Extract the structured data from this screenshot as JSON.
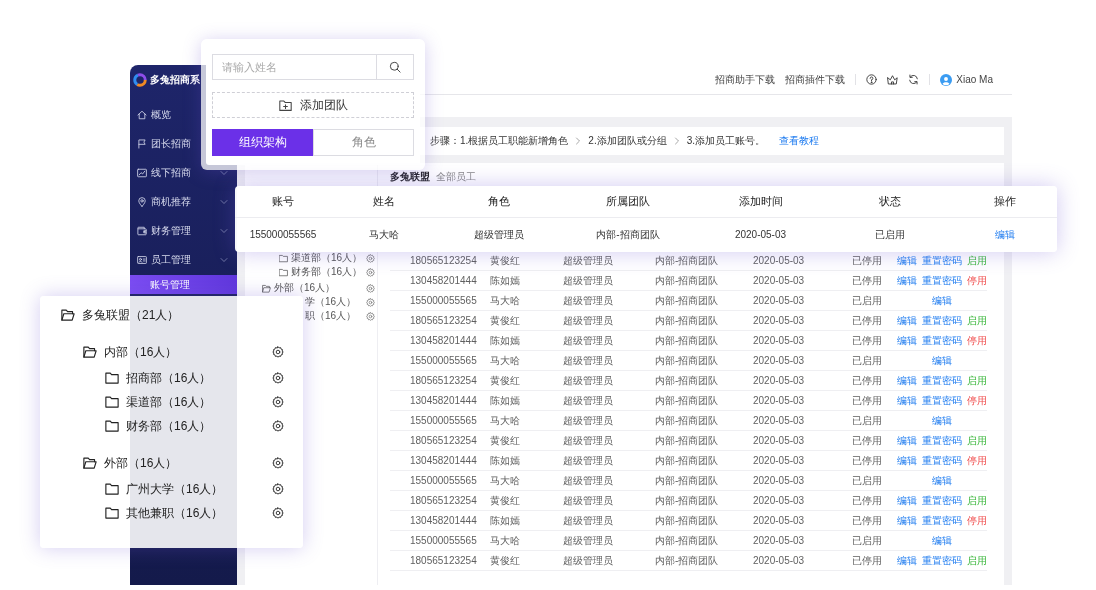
{
  "sidebar": {
    "app_name": "多兔招商系",
    "items": [
      {
        "label": "概览",
        "selected": false
      },
      {
        "label": "团长招商",
        "selected": false
      },
      {
        "label": "线下招商",
        "expandable": true,
        "selected": false
      },
      {
        "label": "商机推荐",
        "expandable": true,
        "selected": false
      },
      {
        "label": "财务管理",
        "expandable": true,
        "selected": false
      },
      {
        "label": "员工管理",
        "expandable": true,
        "selected": false,
        "children": [
          {
            "label": "账号管理",
            "selected": true
          }
        ]
      }
    ]
  },
  "top_bar": {
    "links": [
      "招商助手下载",
      "招商插件下载"
    ],
    "user_name": "Xiao Ma"
  },
  "search_panel": {
    "search": {
      "placeholder": "请输入姓名"
    },
    "add_button": "添加团队",
    "tabs": [
      {
        "label": "组织架构",
        "selected": true
      },
      {
        "label": "角色",
        "selected": false
      }
    ]
  },
  "steps_bar": {
    "steps": [
      "步骤：1.根据员工职能新增角色",
      "2.添加团队或分组",
      "3.添加员工账号。"
    ],
    "link": "查看教程"
  },
  "team_header": {
    "title": "多兔联盟",
    "subtitle": "全部员工"
  },
  "detail_card": {
    "columns": [
      "账号",
      "姓名",
      "角色",
      "所属团队",
      "添加时间",
      "状态",
      "操作"
    ],
    "row": {
      "cells": [
        "155000055565",
        "马大哈",
        "超级管理员",
        "内部-招商团队",
        "2020-05-03",
        "已启用"
      ],
      "actions": [
        {
          "label": "编辑",
          "kind": "edit"
        }
      ]
    }
  },
  "team_tree": [
    {
      "children": [
        {
          "label": "渠道部（16人）",
          "clipped": false
        },
        {
          "label": "财务部（16人）",
          "clipped": false
        }
      ]
    },
    {
      "label": "外部（16人）",
      "clipped": false,
      "children": [
        {
          "label": "学（16人）",
          "clipped": true
        },
        {
          "label": "职（16人）",
          "clipped": true
        }
      ]
    }
  ],
  "employee_table": {
    "rows": [
      {
        "cells": [
          "180565123254",
          "黄俊红",
          "超级管理员",
          "内部-招商团队",
          "2020-05-03",
          "已停用"
        ],
        "actions": [
          {
            "label": "编辑",
            "kind": "edit"
          },
          {
            "label": "重置密码",
            "kind": "reset"
          },
          {
            "label": "启用",
            "kind": "enable"
          }
        ]
      },
      {
        "cells": [
          "130458201444",
          "陈如嫣",
          "超级管理员",
          "内部-招商团队",
          "2020-05-03",
          "已停用"
        ],
        "actions": [
          {
            "label": "编辑",
            "kind": "edit"
          },
          {
            "label": "重置密码",
            "kind": "reset"
          },
          {
            "label": "停用",
            "kind": "disable"
          }
        ]
      },
      {
        "cells": [
          "155000055565",
          "马大哈",
          "超级管理员",
          "内部-招商团队",
          "2020-05-03",
          "已启用"
        ],
        "actions": [
          {
            "label": "编辑",
            "kind": "edit"
          }
        ]
      },
      {
        "cells": [
          "180565123254",
          "黄俊红",
          "超级管理员",
          "内部-招商团队",
          "2020-05-03",
          "已停用"
        ],
        "actions": [
          {
            "label": "编辑",
            "kind": "edit"
          },
          {
            "label": "重置密码",
            "kind": "reset"
          },
          {
            "label": "启用",
            "kind": "enable"
          }
        ]
      },
      {
        "cells": [
          "130458201444",
          "陈如嫣",
          "超级管理员",
          "内部-招商团队",
          "2020-05-03",
          "已停用"
        ],
        "actions": [
          {
            "label": "编辑",
            "kind": "edit"
          },
          {
            "label": "重置密码",
            "kind": "reset"
          },
          {
            "label": "停用",
            "kind": "disable"
          }
        ]
      },
      {
        "cells": [
          "155000055565",
          "马大哈",
          "超级管理员",
          "内部-招商团队",
          "2020-05-03",
          "已启用"
        ],
        "actions": [
          {
            "label": "编辑",
            "kind": "edit"
          }
        ]
      },
      {
        "cells": [
          "180565123254",
          "黄俊红",
          "超级管理员",
          "内部-招商团队",
          "2020-05-03",
          "已停用"
        ],
        "actions": [
          {
            "label": "编辑",
            "kind": "edit"
          },
          {
            "label": "重置密码",
            "kind": "reset"
          },
          {
            "label": "启用",
            "kind": "enable"
          }
        ]
      },
      {
        "cells": [
          "130458201444",
          "陈如嫣",
          "超级管理员",
          "内部-招商团队",
          "2020-05-03",
          "已停用"
        ],
        "actions": [
          {
            "label": "编辑",
            "kind": "edit"
          },
          {
            "label": "重置密码",
            "kind": "reset"
          },
          {
            "label": "停用",
            "kind": "disable"
          }
        ]
      },
      {
        "cells": [
          "155000055565",
          "马大哈",
          "超级管理员",
          "内部-招商团队",
          "2020-05-03",
          "已启用"
        ],
        "actions": [
          {
            "label": "编辑",
            "kind": "edit"
          }
        ]
      },
      {
        "cells": [
          "180565123254",
          "黄俊红",
          "超级管理员",
          "内部-招商团队",
          "2020-05-03",
          "已停用"
        ],
        "actions": [
          {
            "label": "编辑",
            "kind": "edit"
          },
          {
            "label": "重置密码",
            "kind": "reset"
          },
          {
            "label": "启用",
            "kind": "enable"
          }
        ]
      },
      {
        "cells": [
          "130458201444",
          "陈如嫣",
          "超级管理员",
          "内部-招商团队",
          "2020-05-03",
          "已停用"
        ],
        "actions": [
          {
            "label": "编辑",
            "kind": "edit"
          },
          {
            "label": "重置密码",
            "kind": "reset"
          },
          {
            "label": "停用",
            "kind": "disable"
          }
        ]
      },
      {
        "cells": [
          "155000055565",
          "马大哈",
          "超级管理员",
          "内部-招商团队",
          "2020-05-03",
          "已启用"
        ],
        "actions": [
          {
            "label": "编辑",
            "kind": "edit"
          }
        ]
      },
      {
        "cells": [
          "180565123254",
          "黄俊红",
          "超级管理员",
          "内部-招商团队",
          "2020-05-03",
          "已停用"
        ],
        "actions": [
          {
            "label": "编辑",
            "kind": "edit"
          },
          {
            "label": "重置密码",
            "kind": "reset"
          },
          {
            "label": "启用",
            "kind": "enable"
          }
        ]
      },
      {
        "cells": [
          "130458201444",
          "陈如嫣",
          "超级管理员",
          "内部-招商团队",
          "2020-05-03",
          "已停用"
        ],
        "actions": [
          {
            "label": "编辑",
            "kind": "edit"
          },
          {
            "label": "重置密码",
            "kind": "reset"
          },
          {
            "label": "停用",
            "kind": "disable"
          }
        ]
      },
      {
        "cells": [
          "155000055565",
          "马大哈",
          "超级管理员",
          "内部-招商团队",
          "2020-05-03",
          "已启用"
        ],
        "actions": [
          {
            "label": "编辑",
            "kind": "edit"
          }
        ]
      },
      {
        "cells": [
          "180565123254",
          "黄俊红",
          "超级管理员",
          "内部-招商团队",
          "2020-05-03",
          "已停用"
        ],
        "actions": [
          {
            "label": "编辑",
            "kind": "edit"
          },
          {
            "label": "重置密码",
            "kind": "reset"
          },
          {
            "label": "启用",
            "kind": "enable"
          }
        ]
      }
    ]
  },
  "tree_panel": {
    "tree": [
      {
        "label": "多兔联盟（21人）",
        "children": [
          {
            "label": "内部（16人）",
            "children": [
              {
                "label": "招商部（16人）"
              },
              {
                "label": "渠道部（16人）"
              },
              {
                "label": "财务部（16人）"
              }
            ]
          },
          {
            "label": "外部（16人）",
            "children": [
              {
                "label": "广州大学（16人）"
              },
              {
                "label": "其他兼职（16人）"
              }
            ]
          }
        ]
      }
    ]
  }
}
